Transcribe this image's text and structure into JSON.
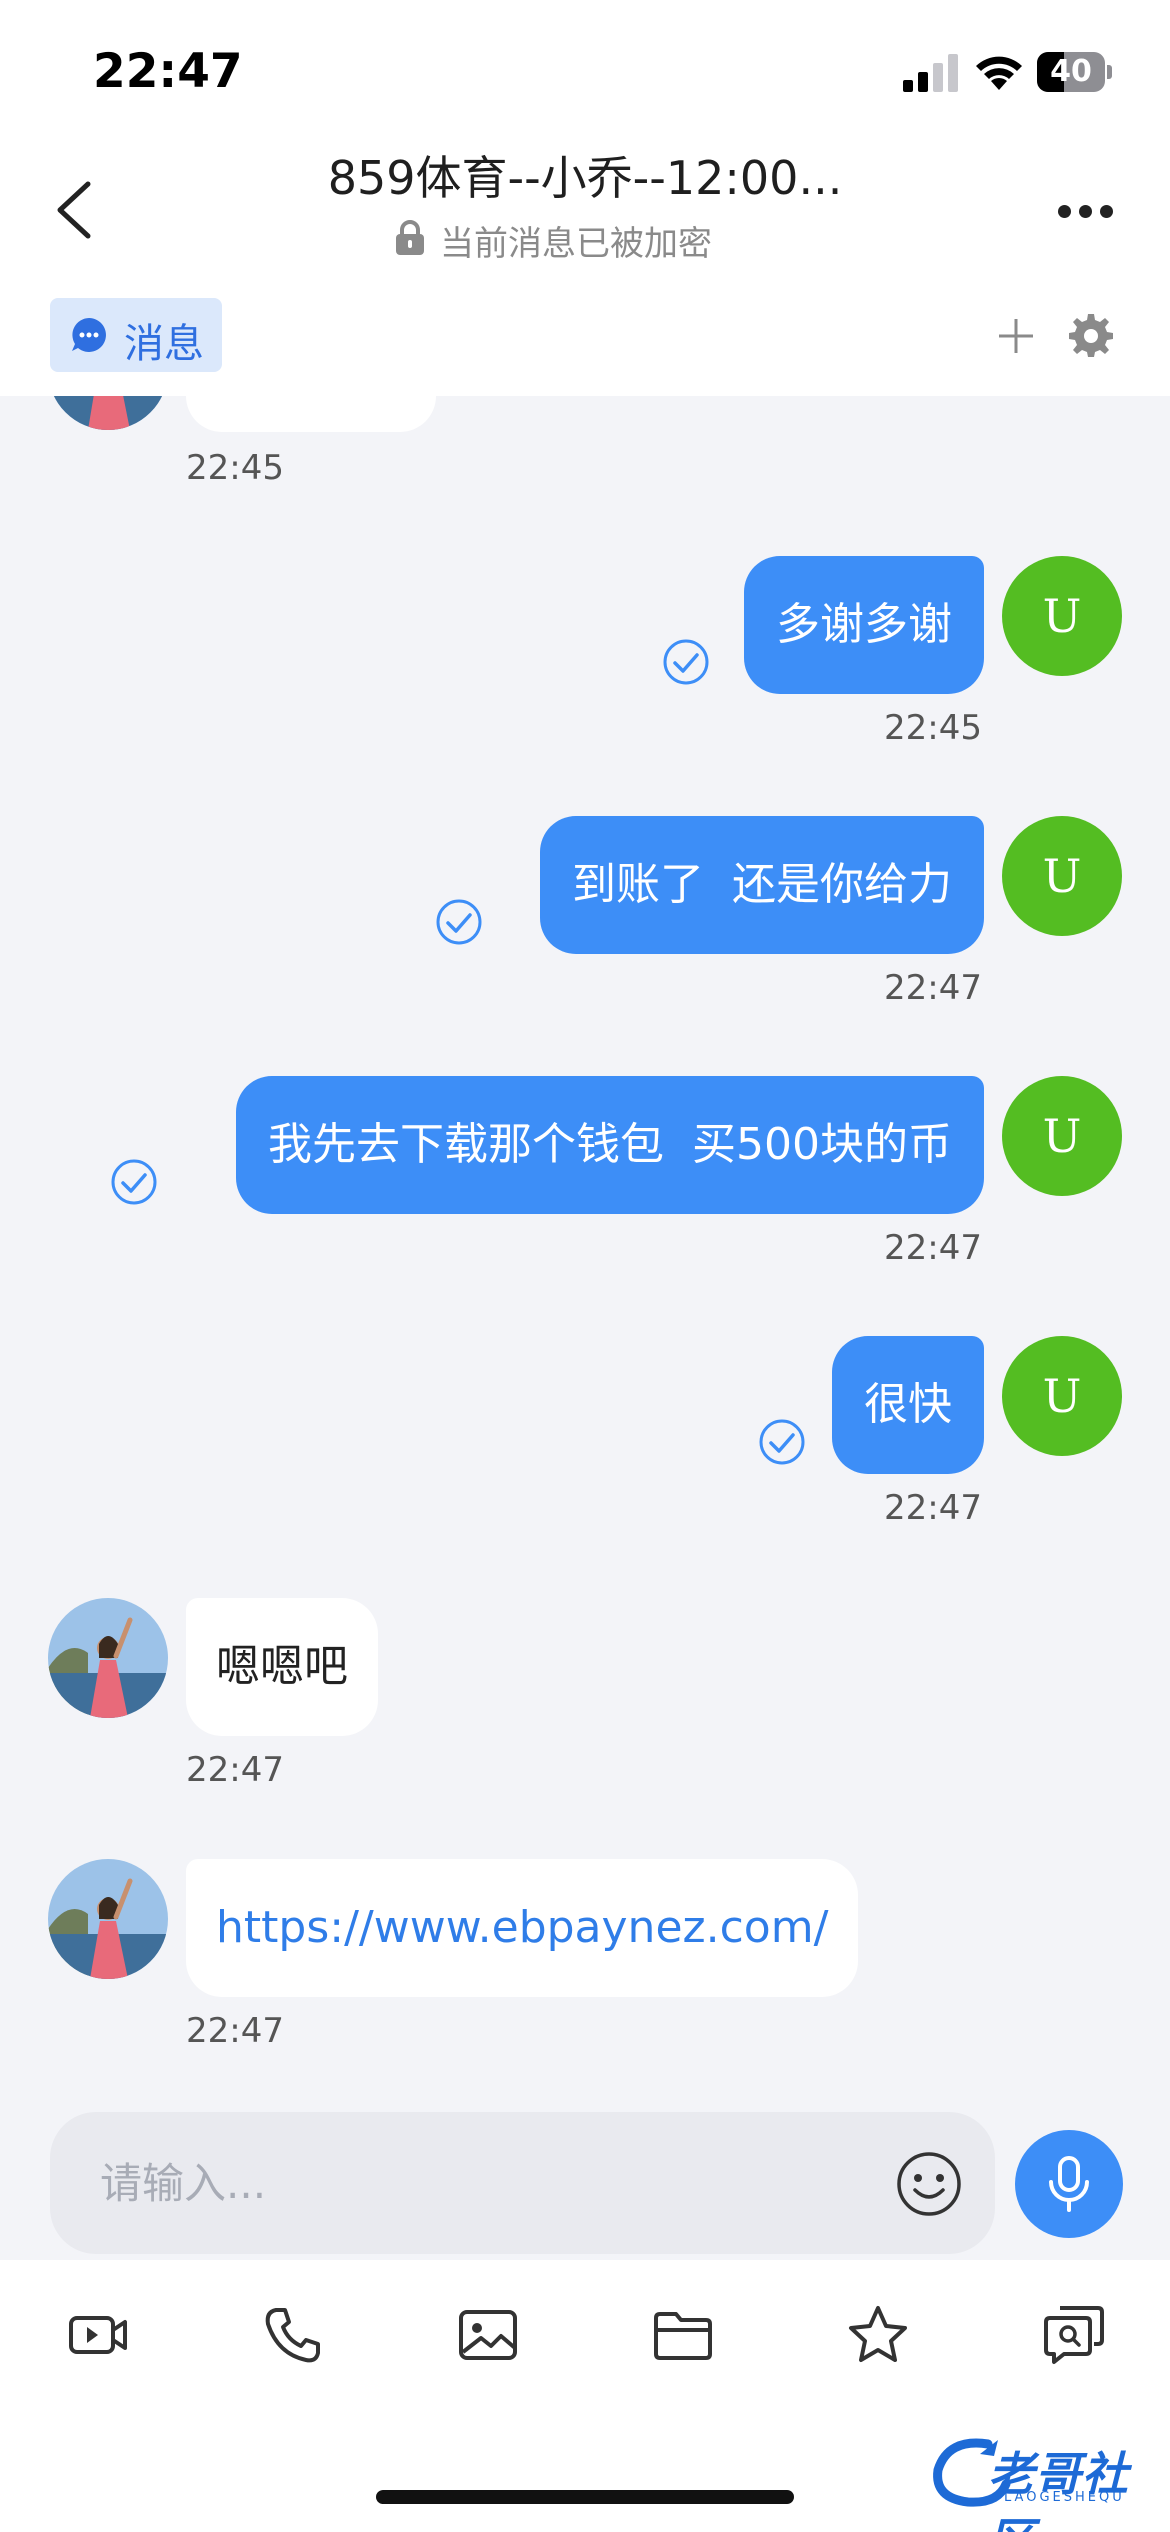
{
  "status_bar": {
    "time": "22:47",
    "battery": "40",
    "battery_level_percent": 40
  },
  "header": {
    "title": "859体育--小乔--12:00...",
    "encryption_text": "当前消息已被加密"
  },
  "tabs": {
    "active_label": "消息"
  },
  "messages": [
    {
      "direction": "in",
      "text": "",
      "time": "22:45"
    },
    {
      "direction": "out",
      "text": "多谢多谢",
      "time": "22:45",
      "avatar": "U"
    },
    {
      "direction": "out",
      "text": "到账了  还是你给力",
      "time": "22:47",
      "avatar": "U"
    },
    {
      "direction": "out",
      "text": "我先去下载那个钱包  买500块的币",
      "time": "22:47",
      "avatar": "U"
    },
    {
      "direction": "out",
      "text": "很快",
      "time": "22:47",
      "avatar": "U"
    },
    {
      "direction": "in",
      "text": "嗯嗯吧",
      "time": "22:47"
    },
    {
      "direction": "in",
      "text": "https://www.ebpaynez.com/",
      "time": "22:47",
      "is_link": true
    }
  ],
  "input": {
    "placeholder": "请输入..."
  },
  "toolbar_icons": [
    "video-icon",
    "phone-icon",
    "image-icon",
    "folder-icon",
    "star-icon",
    "search-chat-icon"
  ],
  "watermark": {
    "text": "老哥社区",
    "subtext": "LAOGESHEQU"
  },
  "colors": {
    "accent": "#3d8ef7",
    "avatar_u": "#54bd22",
    "chat_bg": "#f3f4f8",
    "tab_bg": "#dbe8fb",
    "link": "#2f7de8"
  }
}
